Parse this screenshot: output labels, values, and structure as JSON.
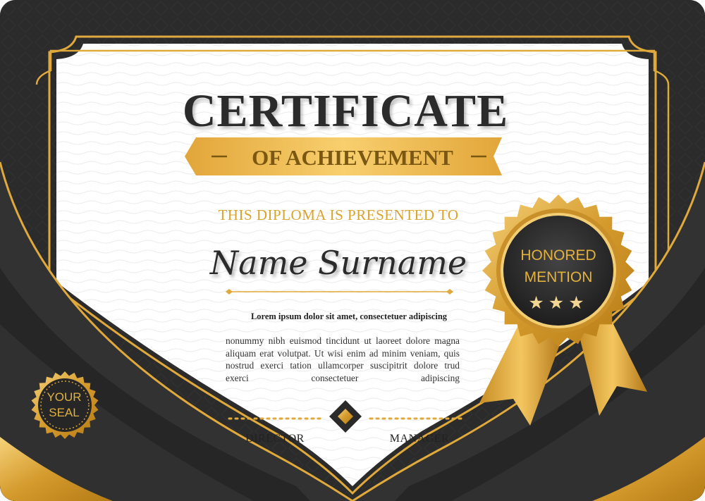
{
  "certificate": {
    "title": "CERTIFICATE",
    "subtitle": "OF ACHIEVEMENT",
    "presented_to": "THIS DIPLOMA IS PRESENTED TO",
    "recipient_name": "Name Surname",
    "lorem_heading": "Lorem ipsum dolor sit amet, consectetuer adipiscing",
    "lorem_body": "nonummy nibh euismod tincidunt ut laoreet dolore magna aliquam erat volutpat. Ut wisi enim ad minim veniam, quis nostrud exerci tation ullamcorper suscipitrit dolore trud exerci consectetuer adipiscing",
    "signatures": {
      "left": "DIRECTOR",
      "right": "MANAGER"
    },
    "badge": {
      "line1": "HONORED",
      "line2": "MENTION",
      "stars": "★★★"
    },
    "seal": {
      "line1": "YOUR",
      "line2": "SEAL"
    }
  },
  "colors": {
    "gold": "#d9a437",
    "dark": "#2a2a2a",
    "paper": "#ffffff"
  },
  "icons": [
    "badge-rosette-icon",
    "ribbon-icon",
    "diamond-ornament-icon",
    "seal-icon",
    "star-icon"
  ]
}
